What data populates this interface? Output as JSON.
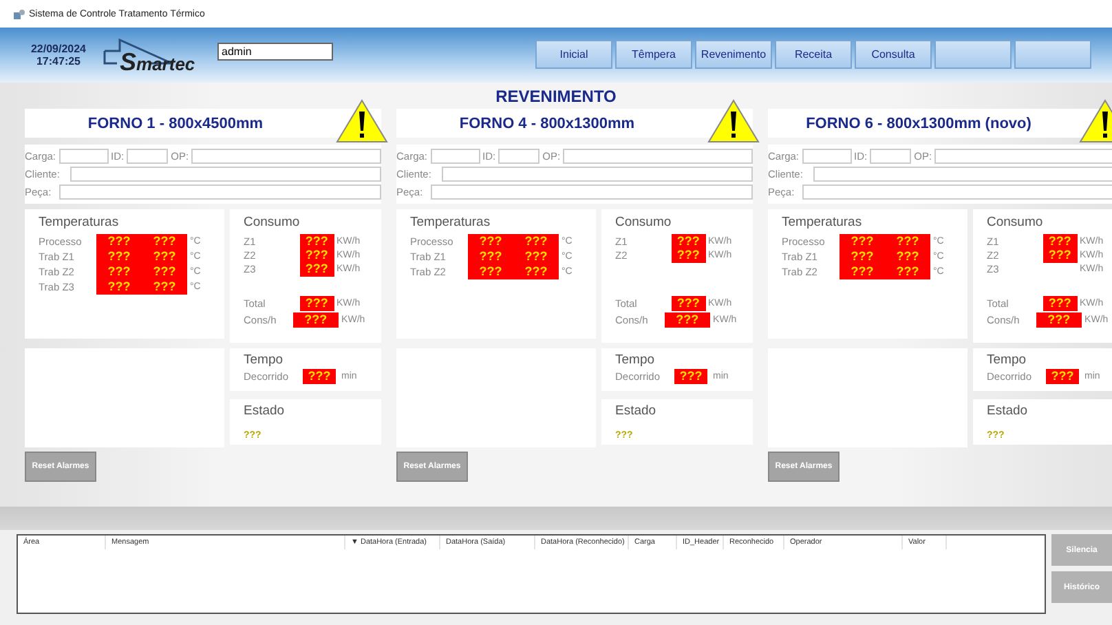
{
  "window": {
    "title": "Sistema de Controle Tratamento Térmico"
  },
  "header": {
    "date": "22/09/2024",
    "time": "17:47:25",
    "logo": "Smartec",
    "user": "admin",
    "nav": [
      {
        "kind": "labeled",
        "label": "Inicial"
      },
      {
        "kind": "labeled",
        "label": "Têmpera"
      },
      {
        "kind": "labeled",
        "label": "Revenimento"
      },
      {
        "kind": "labeled",
        "label": "Receita"
      },
      {
        "kind": "labeled",
        "label": "Consulta"
      },
      {
        "kind": "blank"
      },
      {
        "kind": "blank"
      }
    ]
  },
  "page_title": "REVENIMENTO",
  "furnaces": [
    {
      "title": "FORNO 1 - 800x4500mm",
      "alert": true,
      "fields": [
        "Carga:",
        "ID:",
        "OP:"
      ],
      "cliente": "Cliente:",
      "peca": "Peça:",
      "temperatures": {
        "title": "Temperaturas",
        "rows": [
          {
            "label": "Processo",
            "values": [
              "???",
              "???"
            ],
            "unit": "°C"
          },
          {
            "label": "Trab Z1",
            "values": [
              "???",
              "???"
            ],
            "unit": "°C"
          },
          {
            "label": "Trab Z2",
            "values": [
              "???",
              "???"
            ],
            "unit": "°C"
          },
          {
            "label": "Trab Z3",
            "values": [
              "???",
              "???"
            ],
            "unit": "°C"
          }
        ]
      },
      "consumption": {
        "title": "Consumo",
        "rows": [
          {
            "label": "Z1",
            "value": "???",
            "unit": "KW/h"
          },
          {
            "label": "Z2",
            "value": "???",
            "unit": "KW/h"
          },
          {
            "label": "Z3",
            "value": "???",
            "unit": "KW/h"
          }
        ],
        "totals": [
          {
            "label": "Total",
            "value": "???",
            "unit": "KW/h",
            "kind": "short"
          },
          {
            "label": "Cons/h",
            "value": "???",
            "unit": "KW/h",
            "kind": "wide"
          }
        ]
      },
      "tempo": {
        "title": "Tempo",
        "label": "Decorrido",
        "value": "???",
        "unit": "min"
      },
      "estado": {
        "title": "Estado",
        "value": "???"
      },
      "reset": "Reset Alarmes"
    },
    {
      "title": "FORNO 4 - 800x1300mm",
      "alert": true,
      "fields": [
        "Carga:",
        "ID:",
        "OP:"
      ],
      "cliente": "Cliente:",
      "peca": "Peça:",
      "temperatures": {
        "title": "Temperaturas",
        "rows": [
          {
            "label": "Processo",
            "values": [
              "???",
              "???"
            ],
            "unit": "°C"
          },
          {
            "label": "Trab Z1",
            "values": [
              "???",
              "???"
            ],
            "unit": "°C"
          },
          {
            "label": "Trab Z2",
            "values": [
              "???",
              "???"
            ],
            "unit": "°C"
          }
        ]
      },
      "consumption": {
        "title": "Consumo",
        "rows": [
          {
            "label": "Z1",
            "value": "???",
            "unit": "KW/h"
          },
          {
            "label": "Z2",
            "value": "???",
            "unit": "KW/h"
          }
        ],
        "totals": [
          {
            "label": "Total",
            "value": "???",
            "unit": "KW/h",
            "kind": "short"
          },
          {
            "label": "Cons/h",
            "value": "???",
            "unit": "KW/h",
            "kind": "wide"
          }
        ]
      },
      "tempo": {
        "title": "Tempo",
        "label": "Decorrido",
        "value": "???",
        "unit": "min"
      },
      "estado": {
        "title": "Estado",
        "value": "???"
      },
      "reset": "Reset Alarmes"
    },
    {
      "title": "FORNO 6 - 800x1300mm (novo)",
      "alert": true,
      "fields": [
        "Carga:",
        "ID:",
        "OP:"
      ],
      "cliente": "Cliente:",
      "peca": "Peça:",
      "temperatures": {
        "title": "Temperaturas",
        "rows": [
          {
            "label": "Processo",
            "values": [
              "???",
              "???"
            ],
            "unit": "°C"
          },
          {
            "label": "Trab Z1",
            "values": [
              "???",
              "???"
            ],
            "unit": "°C"
          },
          {
            "label": "Trab Z2",
            "values": [
              "???",
              "???"
            ],
            "unit": "°C"
          }
        ]
      },
      "consumption": {
        "title": "Consumo",
        "rows": [
          {
            "label": "Z1",
            "value": "???",
            "unit": "KW/h"
          },
          {
            "label": "Z2",
            "value": "???",
            "unit": "KW/h"
          },
          {
            "label": "Z3",
            "unit": "KW/h"
          }
        ],
        "totals": [
          {
            "label": "Total",
            "value": "???",
            "unit": "KW/h",
            "kind": "short"
          },
          {
            "label": "Cons/h",
            "value": "???",
            "unit": "KW/h",
            "kind": "wide"
          }
        ]
      },
      "tempo": {
        "title": "Tempo",
        "label": "Decorrido",
        "value": "???",
        "unit": "min"
      },
      "estado": {
        "title": "Estado",
        "value": "???"
      },
      "reset": "Reset Alarmes"
    }
  ],
  "alarms": {
    "columns": [
      "Área",
      "Mensagem",
      "▼ DataHora (Entrada)",
      "DataHora (Saída)",
      "DataHora (Reconhecido)",
      "Carga",
      "ID_Header",
      "Reconhecido",
      "Operador",
      "Valor"
    ]
  },
  "side_buttons": [
    "Silencia",
    "Histórico"
  ]
}
